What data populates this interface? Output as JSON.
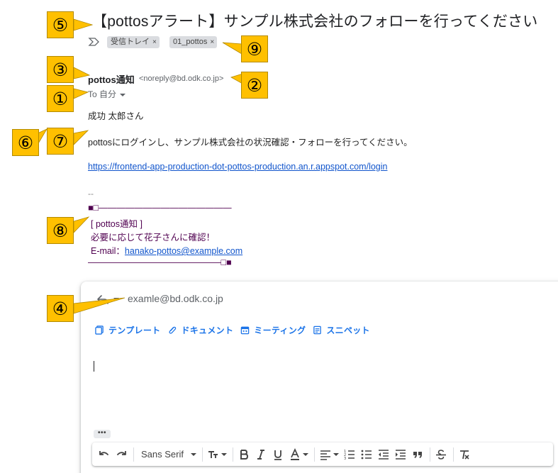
{
  "subject": "【pottosアラート】サンプル株式会社のフォローを行ってください",
  "labels": [
    {
      "name": "受信トレイ",
      "close": "×"
    },
    {
      "name": "01_pottos",
      "close": "×"
    }
  ],
  "sender": {
    "name": "pottos通知",
    "email": "<noreply@bd.odk.co.jp>",
    "to": "To 自分"
  },
  "body": {
    "greeting": "成功 太郎さん",
    "message": "pottosにログインし、サンプル株式会社の状況確認・フォローを行ってください。",
    "link": "https://frontend-app-production-dot-pottos-production.an.r.appspot.com/login",
    "dashes": "--",
    "signature": {
      "line1": "■□―――――――――――――――",
      "line2": "[ pottos通知 ]",
      "line3": "必要に応じて花子さんに確認！",
      "email_label": "E-mail：",
      "email": "hanako-pottos@example.com",
      "line5": "―――――――――――――――□■"
    }
  },
  "reply": {
    "recipient": "examle@bd.odk.co.jp",
    "addons": [
      "テンプレート",
      "ドキュメント",
      "ミーティング",
      "スニペット"
    ],
    "more_label": "•••"
  },
  "format_bar": {
    "font": "Sans Serif"
  },
  "callouts": [
    "①",
    "②",
    "③",
    "④",
    "⑤",
    "⑥",
    "⑦",
    "⑧",
    "⑨"
  ],
  "colors": {
    "callout": "#ffc000",
    "link": "#1155cc",
    "signature": "#500050",
    "addon": "#1a73e8",
    "chip": "#dadce0"
  }
}
